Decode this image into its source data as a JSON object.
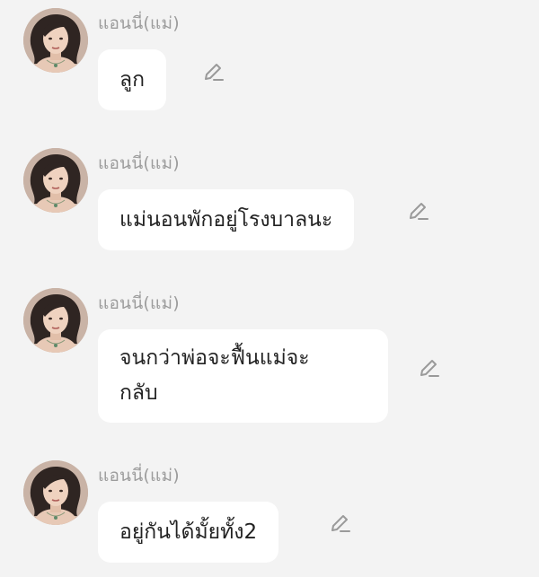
{
  "messages": [
    {
      "sender": "แอนนี่(แม่)",
      "text": "ลูก"
    },
    {
      "sender": "แอนนี่(แม่)",
      "text": "แม่นอนพักอยู่โรงบาลนะ"
    },
    {
      "sender": "แอนนี่(แม่)",
      "text": "จนกว่าพ่อจะฟื้นแม่จะ\nกลับ"
    },
    {
      "sender": "แอนนี่(แม่)",
      "text": "อยู่กันได้มั้ยทั้ง2"
    }
  ],
  "icons": {
    "edit": "pencil-edit-icon",
    "avatar": "avatar-portrait"
  },
  "colors": {
    "background": "#f3f3f3",
    "bubble": "#ffffff",
    "sender_text": "#9c9c9c",
    "message_text": "#222222",
    "icon": "#9a9a9a"
  }
}
